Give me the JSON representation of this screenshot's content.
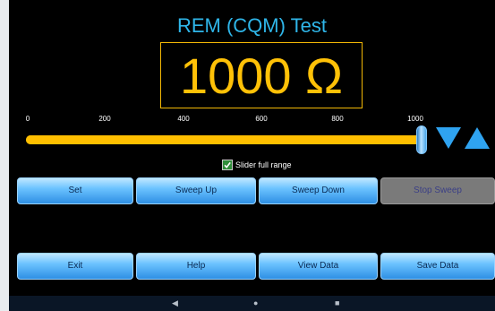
{
  "app": {
    "title": "REM (CQM) Test",
    "display_value": "1000 Ω"
  },
  "slider": {
    "min": 0,
    "max": 1000,
    "value": 1000,
    "tick_labels": [
      "0",
      "200",
      "400",
      "600",
      "800",
      "1000"
    ],
    "track_color": "#f9b800"
  },
  "arrows": {
    "down_icon": "triangle-down-icon",
    "up_icon": "triangle-up-icon",
    "color": "#2fa3f0"
  },
  "checkbox": {
    "label": "Slider full range",
    "checked": true
  },
  "buttons": {
    "set": "Set",
    "sweep_up": "Sweep Up",
    "sweep_down": "Sweep Down",
    "stop_sweep": "Stop Sweep",
    "exit": "Exit",
    "help": "Help",
    "view_data": "View Data",
    "save_data": "Save Data"
  },
  "navbar": {
    "back_icon": "back-icon",
    "home_icon": "home-icon",
    "recents_icon": "recents-icon"
  }
}
